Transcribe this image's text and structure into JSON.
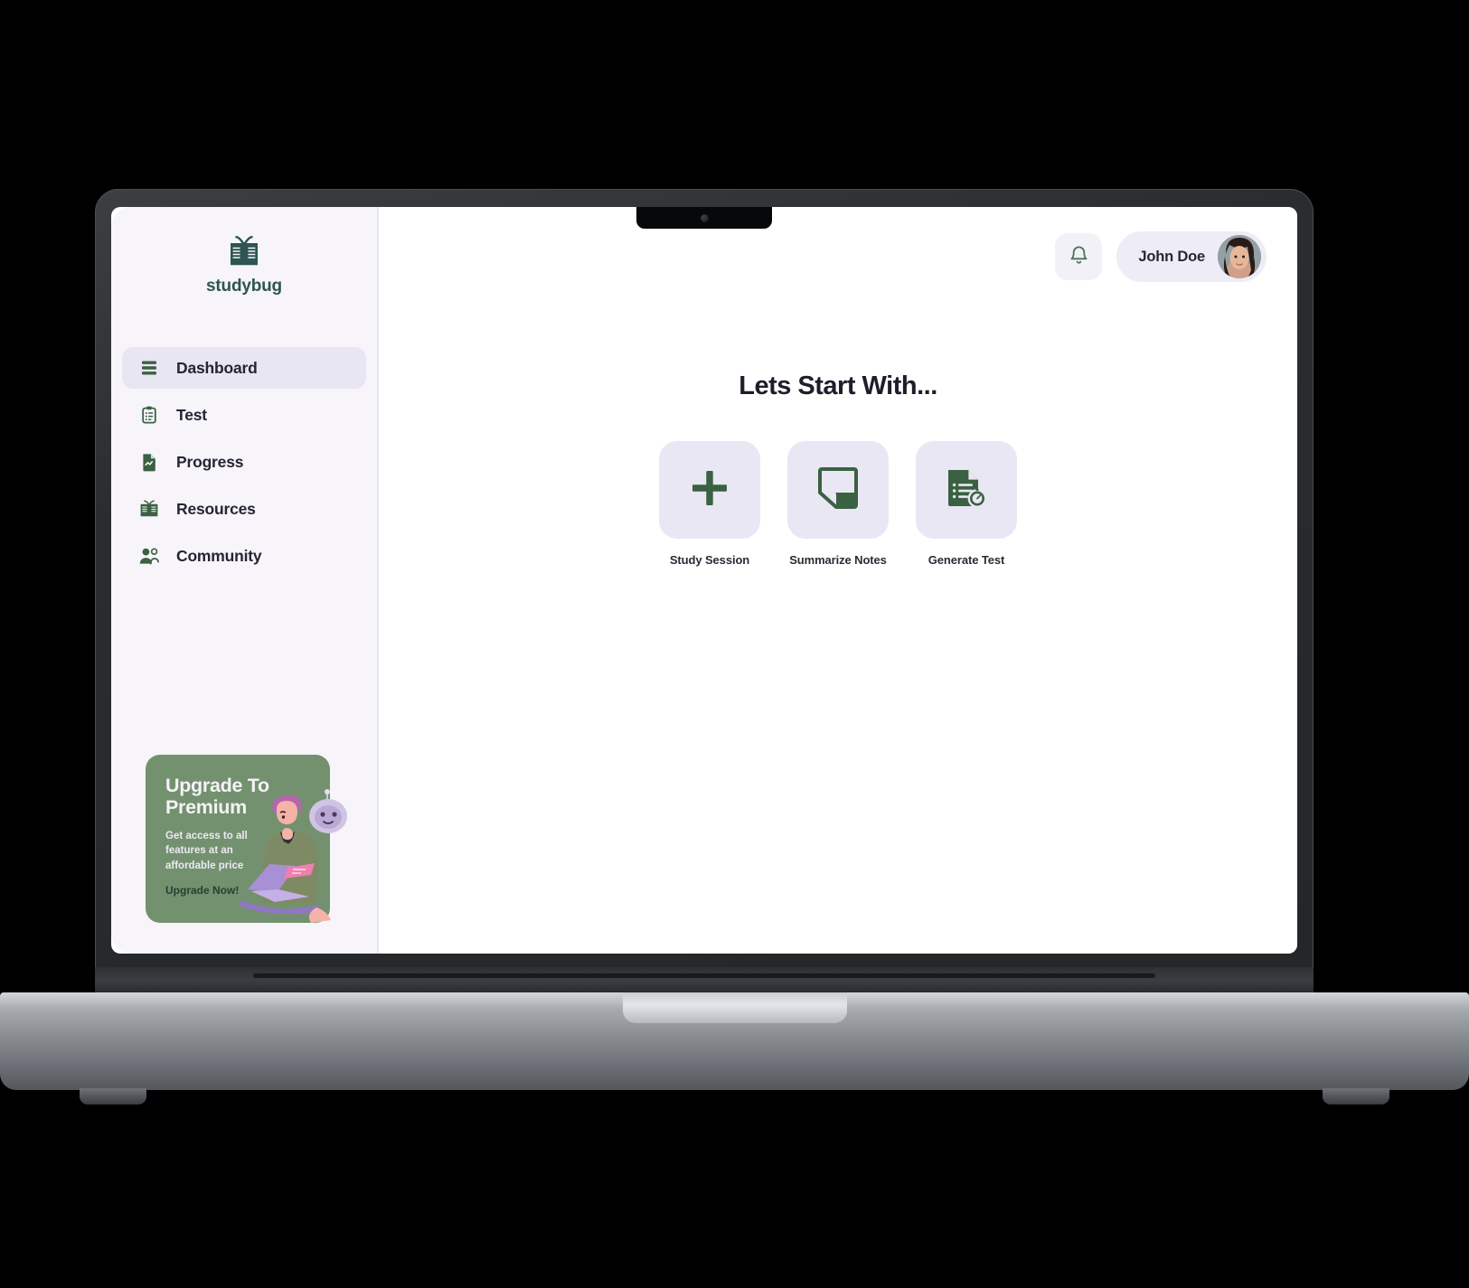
{
  "brand": {
    "name": "studybug",
    "logo_icon": "open-book-icon",
    "color": "#2d5551"
  },
  "sidebar": {
    "items": [
      {
        "label": "Dashboard",
        "icon": "stacked-lines-icon",
        "active": true
      },
      {
        "label": "Test",
        "icon": "clipboard-icon",
        "active": false
      },
      {
        "label": "Progress",
        "icon": "document-chart-icon",
        "active": false
      },
      {
        "label": "Resources",
        "icon": "open-book-icon",
        "active": false
      },
      {
        "label": "Community",
        "icon": "two-people-icon",
        "active": false
      }
    ],
    "promo": {
      "title": "Upgrade To Premium",
      "subtitle": "Get access to all features at an affordable price",
      "cta": "Upgrade Now!",
      "bg_color": "#74916f",
      "cta_color": "#24402f",
      "art_icon": "person-with-laptop-and-robot-illustration"
    }
  },
  "topbar": {
    "notification_icon": "bell-icon",
    "user": {
      "name": "John Doe",
      "avatar_icon": "user-photo-avatar"
    }
  },
  "main": {
    "headline": "Lets Start With...",
    "actions": [
      {
        "label": "Study Session",
        "icon": "plus-icon"
      },
      {
        "label": "Summarize Notes",
        "icon": "note-folded-corner-icon"
      },
      {
        "label": "Generate Test",
        "icon": "document-with-timer-icon"
      }
    ]
  },
  "device": {
    "type": "laptop-mockup",
    "camera_icon": "webcam-dot",
    "accent_green": "#3a6141",
    "tile_bg": "#e9e7f3",
    "sidebar_bg": "#f7f5fa"
  }
}
